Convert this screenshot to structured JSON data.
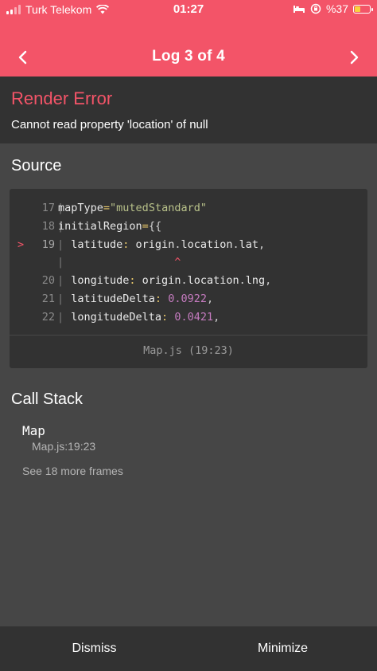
{
  "status": {
    "carrier": "Turk Telekom",
    "time": "01:27",
    "battery": "%37"
  },
  "header": {
    "title": "Log 3 of 4",
    "prev_icon": "chevron-left-icon",
    "next_icon": "chevron-right-icon"
  },
  "error": {
    "title": "Render Error",
    "message": "Cannot read property 'location' of null"
  },
  "source": {
    "title": "Source",
    "lines": [
      {
        "num": "17",
        "code": "mapType=\"mutedStandard\""
      },
      {
        "num": "18",
        "code": "initialRegion={{"
      },
      {
        "num": "19",
        "code": "  latitude: origin.location.lat,"
      },
      {
        "num": "",
        "code": "                  ^"
      },
      {
        "num": "20",
        "code": "  longitude: origin.location.lng,"
      },
      {
        "num": "21",
        "code": "  latitudeDelta: 0.0922,"
      },
      {
        "num": "22",
        "code": "  longitudeDelta: 0.0421,"
      }
    ],
    "highlight_marker": ">",
    "file": "Map.js (19:23)"
  },
  "call_stack": {
    "title": "Call Stack",
    "frame_name": "Map",
    "frame_location": "Map.js:19:23",
    "more": "See 18 more frames"
  },
  "footer": {
    "dismiss": "Dismiss",
    "minimize": "Minimize"
  },
  "colors": {
    "accent": "#f35468",
    "background": "#464646",
    "panel": "#323232"
  }
}
